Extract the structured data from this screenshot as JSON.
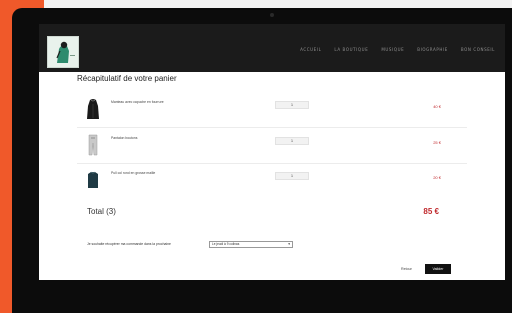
{
  "nav": {
    "links": [
      "ACCUEIL",
      "LA BOUTIQUE",
      "MUSIQUE",
      "BIOGRAPHIE",
      "BON CONSEIL"
    ]
  },
  "cart": {
    "title": "Récapitulatif de votre panier",
    "items": [
      {
        "name": "Manteau avec capuche en fourrure",
        "quantity": "1",
        "price": "40 €"
      },
      {
        "name": "Pantalon boutons",
        "quantity": "1",
        "price": "25 €"
      },
      {
        "name": "Pull col rond en grosse maille",
        "quantity": "1",
        "price": "20 €"
      }
    ],
    "total_label": "Total (3)",
    "total_value": "85 €"
  },
  "delivery": {
    "label": "Je souhaite récupérer ma commande dans la prochaine",
    "selected": "Le jeudi à 9 colinas"
  },
  "actions": {
    "back_label": "Retour",
    "validate_label": "Valider"
  },
  "colors": {
    "accent_orange": "#f0592a",
    "price_red": "#c0292d",
    "navbar": "#1b1b1b"
  }
}
